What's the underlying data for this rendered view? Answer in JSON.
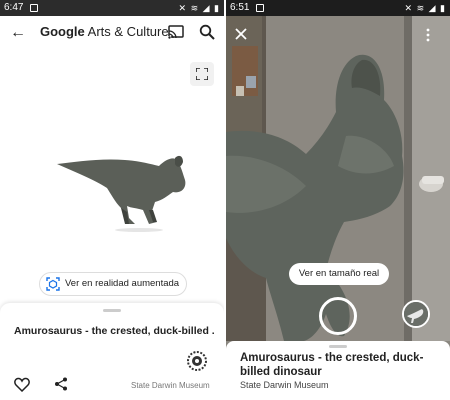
{
  "left_screen": {
    "status_time": "6:47",
    "app_title_brand": "Google",
    "app_title_rest": " Arts & Culture",
    "ar_button_label": "Ver en realidad aumentada",
    "item_title": "Amurosaurus - the crested, duck-billed ...",
    "museum_name": "State Darwin Museum"
  },
  "right_screen": {
    "status_time": "6:51",
    "size_button_label": "Ver en tamaño real",
    "item_title": "Amurosaurus - the crested, duck-billed dinosaur",
    "museum_name": "State Darwin Museum"
  },
  "icons": {
    "back": "arrow-left-icon",
    "cast": "cast-icon",
    "search": "search-icon",
    "fullscreen": "fullscreen-icon",
    "ar": "ar-icon",
    "favorite": "heart-icon",
    "share": "share-icon",
    "close": "close-icon",
    "menu": "more-vert-icon"
  },
  "colors": {
    "accent_blue": "#1a73e8",
    "status_bar_left": "#2c2c2c",
    "status_bar_right": "#1d1d1d",
    "text_primary": "#222222"
  }
}
